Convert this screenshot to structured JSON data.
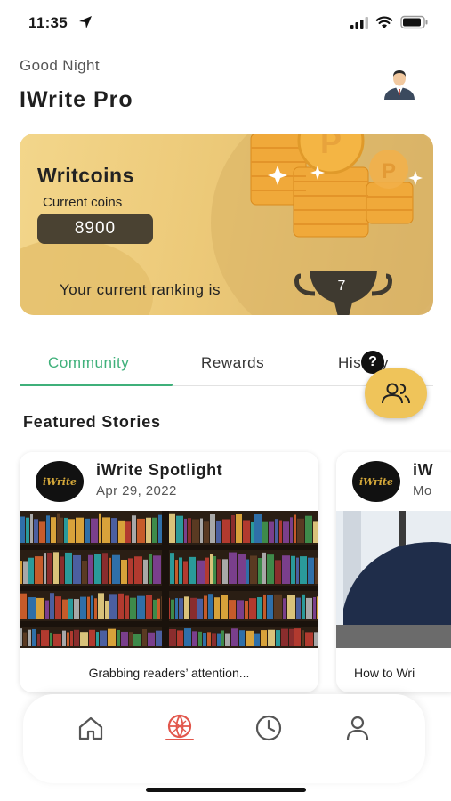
{
  "status_bar": {
    "time": "11:35"
  },
  "header": {
    "greeting": "Good Night",
    "title": "IWrite Pro"
  },
  "coins_card": {
    "title": "Writcoins",
    "subtitle": "Current coins",
    "coins": "8900",
    "ranking_label": "Your current ranking is",
    "ranking_value": "7"
  },
  "tabs": [
    {
      "label": "Community",
      "active": true
    },
    {
      "label": "Rewards",
      "active": false
    },
    {
      "label": "History",
      "active": false
    }
  ],
  "help_badge": "?",
  "featured": {
    "title": "Featured Stories",
    "stories": [
      {
        "logo_text": "iWrite",
        "author": "iWrite Spotlight",
        "date": "Apr 29, 2022",
        "caption": "Grabbing readers’ attention..."
      },
      {
        "logo_text": "iWrite",
        "author": "iW",
        "date": "Mo",
        "caption": "How to Wri"
      }
    ]
  },
  "bottom_nav": {
    "items": [
      "home-icon",
      "explore-icon",
      "history-icon",
      "profile-icon"
    ],
    "active": "explore-icon"
  },
  "colors": {
    "accent_green": "#3fb07a",
    "accent_red": "#e2574c",
    "coin_gold": "#efc45a",
    "pill_dark": "#4a4232"
  }
}
